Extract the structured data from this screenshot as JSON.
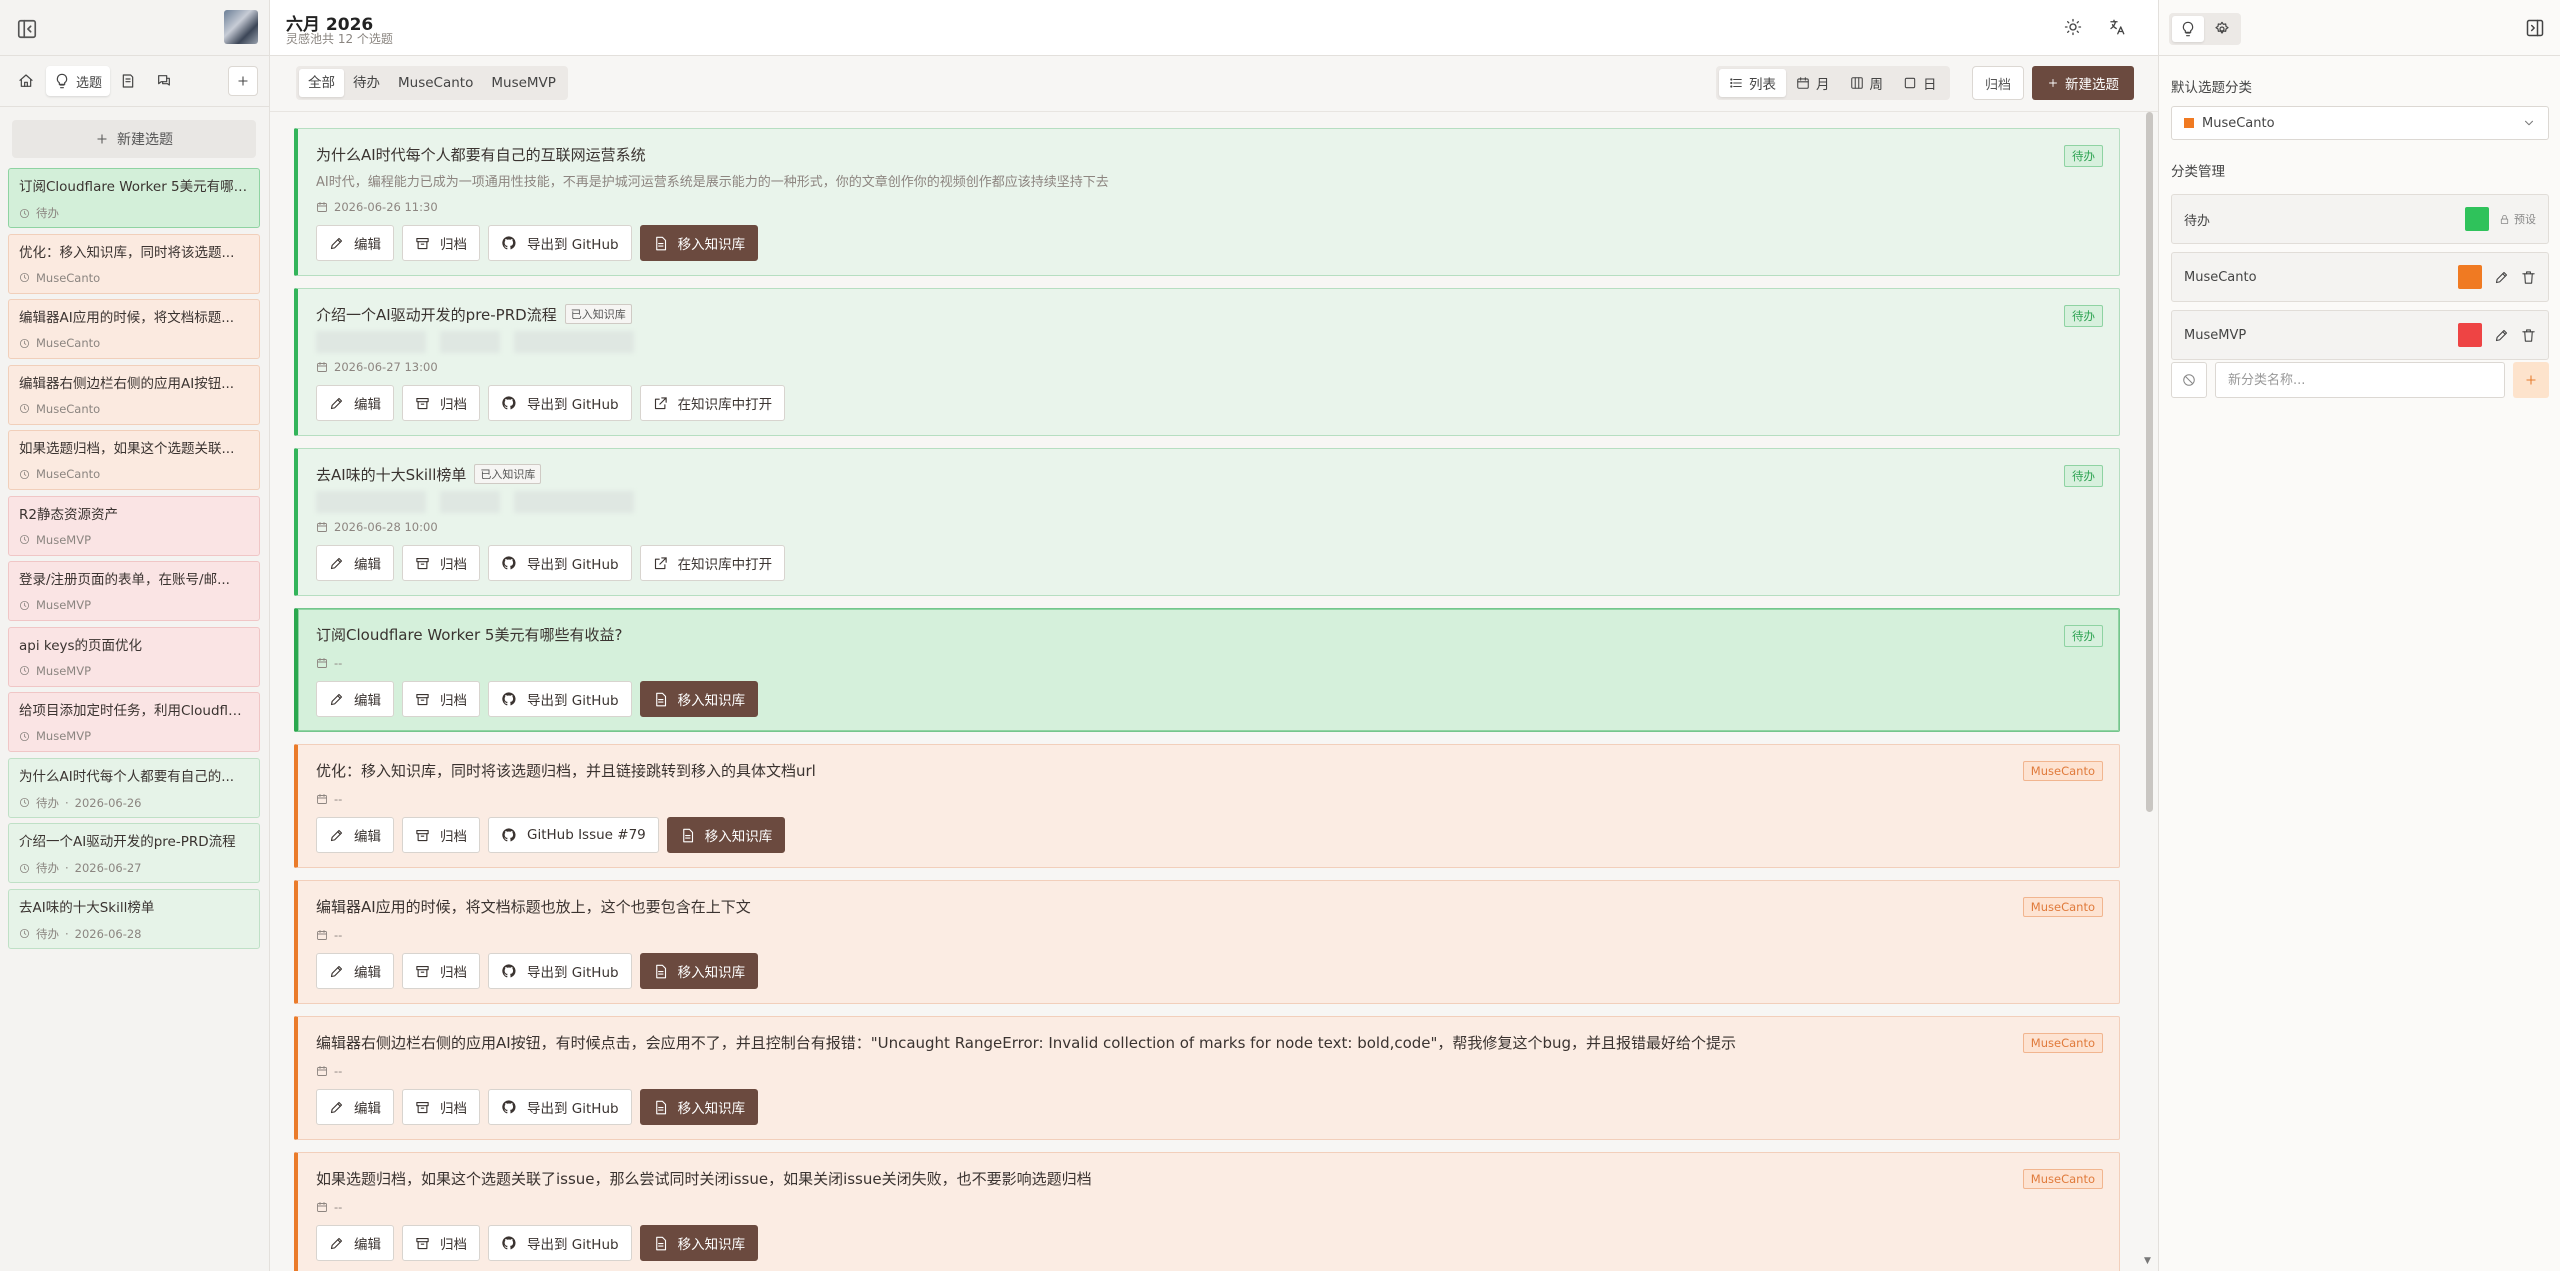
{
  "header": {
    "title": "六月 2026",
    "subtitle": "灵感池共 12 个选题"
  },
  "left_tabs": [
    {
      "icon": "home-icon",
      "label": ""
    },
    {
      "icon": "bulb-icon",
      "label": "选题"
    },
    {
      "icon": "book-icon",
      "label": ""
    },
    {
      "icon": "chat-icon",
      "label": ""
    }
  ],
  "sidebar": {
    "new_topic": "新建选题",
    "items": [
      {
        "title": "订阅Cloudflare Worker 5美元有哪些...",
        "category": "待办",
        "date": "",
        "color": "green",
        "active": true
      },
      {
        "title": "优化：移入知识库，同时将该选题...",
        "category": "MuseCanto",
        "date": "",
        "color": "orange"
      },
      {
        "title": "编辑器AI应用的时候，将文档标题...",
        "category": "MuseCanto",
        "date": "",
        "color": "orange"
      },
      {
        "title": "编辑器右侧边栏右侧的应用AI按钮...",
        "category": "MuseCanto",
        "date": "",
        "color": "orange"
      },
      {
        "title": "如果选题归档，如果这个选题关联...",
        "category": "MuseCanto",
        "date": "",
        "color": "orange"
      },
      {
        "title": "R2静态资源资产",
        "category": "MuseMVP",
        "date": "",
        "color": "red"
      },
      {
        "title": "登录/注册页面的表单，在账号/邮...",
        "category": "MuseMVP",
        "date": "",
        "color": "red"
      },
      {
        "title": "api keys的页面优化",
        "category": "MuseMVP",
        "date": "",
        "color": "red"
      },
      {
        "title": "给项目添加定时任务，利用Cloudfla...",
        "category": "MuseMVP",
        "date": "",
        "color": "red"
      },
      {
        "title": "为什么AI时代每个人都要有自己的...",
        "category": "待办",
        "date": "2026-06-26",
        "color": "green"
      },
      {
        "title": "介绍一个AI驱动开发的pre-PRD流程",
        "category": "待办",
        "date": "2026-06-27",
        "color": "green"
      },
      {
        "title": "去AI味的十大Skill榜单",
        "category": "待办",
        "date": "2026-06-28",
        "color": "green"
      }
    ]
  },
  "filters": [
    "全部",
    "待办",
    "MuseCanto",
    "MuseMVP"
  ],
  "views": [
    {
      "icon": "list-icon",
      "label": "列表"
    },
    {
      "icon": "calendar-icon",
      "label": "月"
    },
    {
      "icon": "columns-icon",
      "label": "周"
    },
    {
      "icon": "square-icon",
      "label": "日"
    }
  ],
  "toolbar": {
    "archive": "归档",
    "new_topic": "新建选题"
  },
  "cards": [
    {
      "title": "为什么AI时代每个人都要有自己的互联网运营系统",
      "kb": "",
      "desc": "AI时代，编程能力已成为一项通用性技能，不再是护城河运营系统是展示能力的一种形式，你的文章创作你的视频创作都应该持续坚持下去",
      "date": "2026-06-26 11:30",
      "tag": "待办",
      "color": "green",
      "blur": false,
      "buttons": [
        "编辑",
        "归档",
        "导出到 GitHub",
        "移入知识库"
      ],
      "last_dark": true
    },
    {
      "title": "介绍一个AI驱动开发的pre-PRD流程",
      "kb": "已入知识库",
      "desc": "",
      "date": "2026-06-27 13:00",
      "tag": "待办",
      "color": "green",
      "blur": true,
      "buttons": [
        "编辑",
        "归档",
        "导出到 GitHub",
        "在知识库中打开"
      ],
      "last_dark": false
    },
    {
      "title": "去AI味的十大Skill榜单",
      "kb": "已入知识库",
      "desc": "",
      "date": "2026-06-28 10:00",
      "tag": "待办",
      "color": "green",
      "blur": true,
      "buttons": [
        "编辑",
        "归档",
        "导出到 GitHub",
        "在知识库中打开"
      ],
      "last_dark": false
    },
    {
      "title": "订阅Cloudflare Worker 5美元有哪些有收益?",
      "kb": "",
      "desc": "",
      "date": "--",
      "tag": "待办",
      "color": "green",
      "selected": true,
      "blur": false,
      "buttons": [
        "编辑",
        "归档",
        "导出到 GitHub",
        "移入知识库"
      ],
      "last_dark": true
    },
    {
      "title": "优化：移入知识库，同时将该选题归档，并且链接跳转到移入的具体文档url",
      "kb": "",
      "desc": "",
      "date": "--",
      "tag": "MuseCanto",
      "color": "orange",
      "blur": false,
      "buttons": [
        "编辑",
        "归档",
        "GitHub Issue #79",
        "移入知识库"
      ],
      "last_dark": true
    },
    {
      "title": "编辑器AI应用的时候，将文档标题也放上，这个也要包含在上下文",
      "kb": "",
      "desc": "",
      "date": "--",
      "tag": "MuseCanto",
      "color": "orange",
      "blur": false,
      "buttons": [
        "编辑",
        "归档",
        "导出到 GitHub",
        "移入知识库"
      ],
      "last_dark": true
    },
    {
      "title": "编辑器右侧边栏右侧的应用AI按钮，有时候点击，会应用不了，并且控制台有报错：\"Uncaught RangeError: Invalid collection of marks for node text: bold,code\"，帮我修复这个bug，并且报错最好给个提示",
      "kb": "",
      "desc": "",
      "date": "--",
      "tag": "MuseCanto",
      "color": "orange",
      "blur": false,
      "buttons": [
        "编辑",
        "归档",
        "导出到 GitHub",
        "移入知识库"
      ],
      "last_dark": true
    },
    {
      "title": "如果选题归档，如果这个选题关联了issue，那么尝试同时关闭issue，如果关闭issue关闭失败，也不要影响选题归档",
      "kb": "",
      "desc": "",
      "date": "--",
      "tag": "MuseCanto",
      "color": "orange",
      "blur": false,
      "buttons": [
        "编辑",
        "归档",
        "导出到 GitHub",
        "移入知识库"
      ],
      "last_dark": true
    }
  ],
  "right": {
    "default_label": "默认选题分类",
    "default_value": "MuseCanto",
    "manage_label": "分类管理",
    "categories": [
      {
        "name": "待办",
        "color": "#2fc25b",
        "preset": "预设"
      },
      {
        "name": "MuseCanto",
        "color": "#f07a22"
      },
      {
        "name": "MuseMVP",
        "color": "#ee4444"
      }
    ],
    "new_placeholder": "新分类名称..."
  },
  "colors": {
    "accent": "#6b4a3f",
    "green": "#33b45a",
    "orange": "#ea7b2a",
    "red": "#ee4444"
  }
}
